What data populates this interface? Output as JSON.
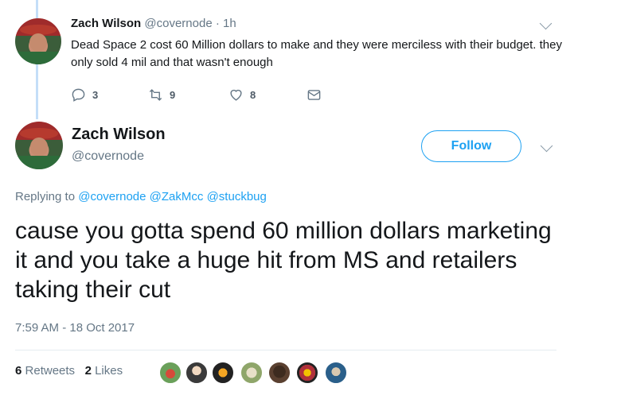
{
  "parent_tweet": {
    "name": "Zach Wilson",
    "handle": "@covernode",
    "separator": "·",
    "time": "1h",
    "text": "Dead Space 2 cost 60 Million dollars to make and they were merciless with their budget. they only sold 4 mil and that wasn't enough",
    "replies": "3",
    "retweets": "9",
    "likes": "8"
  },
  "main_tweet": {
    "name": "Zach Wilson",
    "handle": "@covernode",
    "follow_label": "Follow",
    "replying_prefix": "Replying to",
    "replying_to": [
      "@covernode",
      "@ZakMcc",
      "@stuckbug"
    ],
    "text": "cause you gotta spend 60 million dollars marketing it and you take a huge hit from MS and retailers taking their cut",
    "timestamp": "7:59 AM - 18 Oct 2017",
    "retweets_count": "6",
    "retweets_label": "Retweets",
    "likes_count": "2",
    "likes_label": "Likes"
  },
  "icons": {
    "reply": "reply-icon",
    "retweet": "retweet-icon",
    "like": "heart-icon",
    "dm": "envelope-icon",
    "more": "chevron-down-icon"
  },
  "colors": {
    "accent": "#1da1f2",
    "thread_line": "#c4def8",
    "muted": "#657786"
  }
}
